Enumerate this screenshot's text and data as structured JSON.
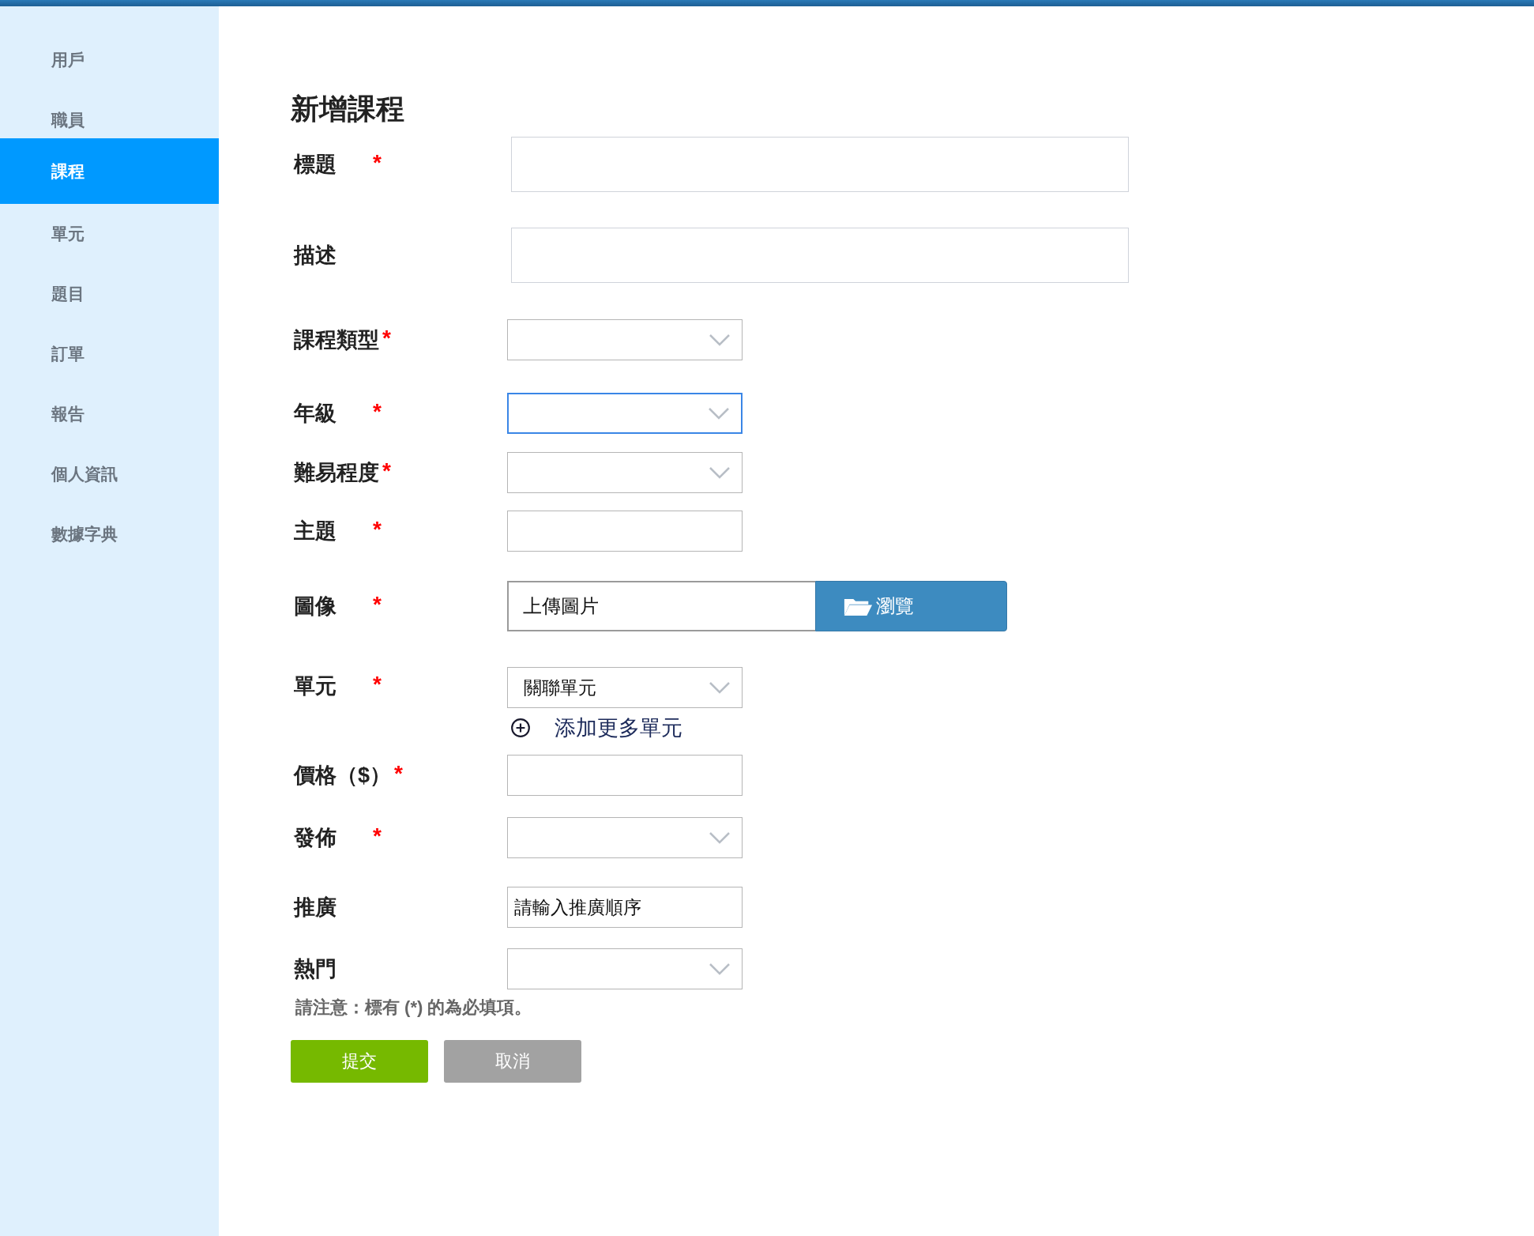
{
  "sidebar": {
    "items": [
      {
        "label": "用戶",
        "selected": false
      },
      {
        "label": "職員",
        "selected": false
      },
      {
        "label": "課程",
        "selected": true
      },
      {
        "label": "單元",
        "selected": false
      },
      {
        "label": "題目",
        "selected": false
      },
      {
        "label": "訂單",
        "selected": false
      },
      {
        "label": "報告",
        "selected": false
      },
      {
        "label": "個人資訊",
        "selected": false
      },
      {
        "label": "數據字典",
        "selected": false
      }
    ]
  },
  "form": {
    "title": "新增課程",
    "fields": [
      {
        "kind": "wide_text",
        "label": "標題",
        "required_mark": "*",
        "focused": false
      },
      {
        "kind": "wide_text",
        "label": "描述",
        "focused": false
      },
      {
        "kind": "select",
        "label": "課程類型",
        "required_mark": "*",
        "focused": false
      },
      {
        "kind": "select",
        "label": "年級",
        "required_mark": "*",
        "focused": true
      },
      {
        "kind": "select",
        "label": "難易程度",
        "required_mark": "*",
        "focused": false
      },
      {
        "kind": "text",
        "label": "主題",
        "required_mark": "*",
        "focused": false
      },
      {
        "kind": "file",
        "label": "圖像",
        "required_mark": "*",
        "value": "上傳圖片",
        "button": "瀏覽",
        "focused": false
      },
      {
        "kind": "select",
        "label": "單元",
        "required_mark": "*",
        "value": "關聯單元",
        "focused": false
      },
      {
        "kind": "link",
        "label": "添加更多單元"
      },
      {
        "kind": "text",
        "label": "價格（$）",
        "required_mark": "*",
        "focused": false
      },
      {
        "kind": "select",
        "label": "發佈",
        "required_mark": "*",
        "focused": false
      },
      {
        "kind": "text",
        "label": "推廣",
        "value": "請輸入推廣順序",
        "focused": false
      },
      {
        "kind": "select",
        "label": "熱門",
        "focused": false
      }
    ],
    "note": "請注意：標有 (*) 的為必填項。",
    "buttons": [
      {
        "kind": "submit",
        "label": "提交"
      },
      {
        "kind": "cancel",
        "label": "取消"
      }
    ]
  }
}
